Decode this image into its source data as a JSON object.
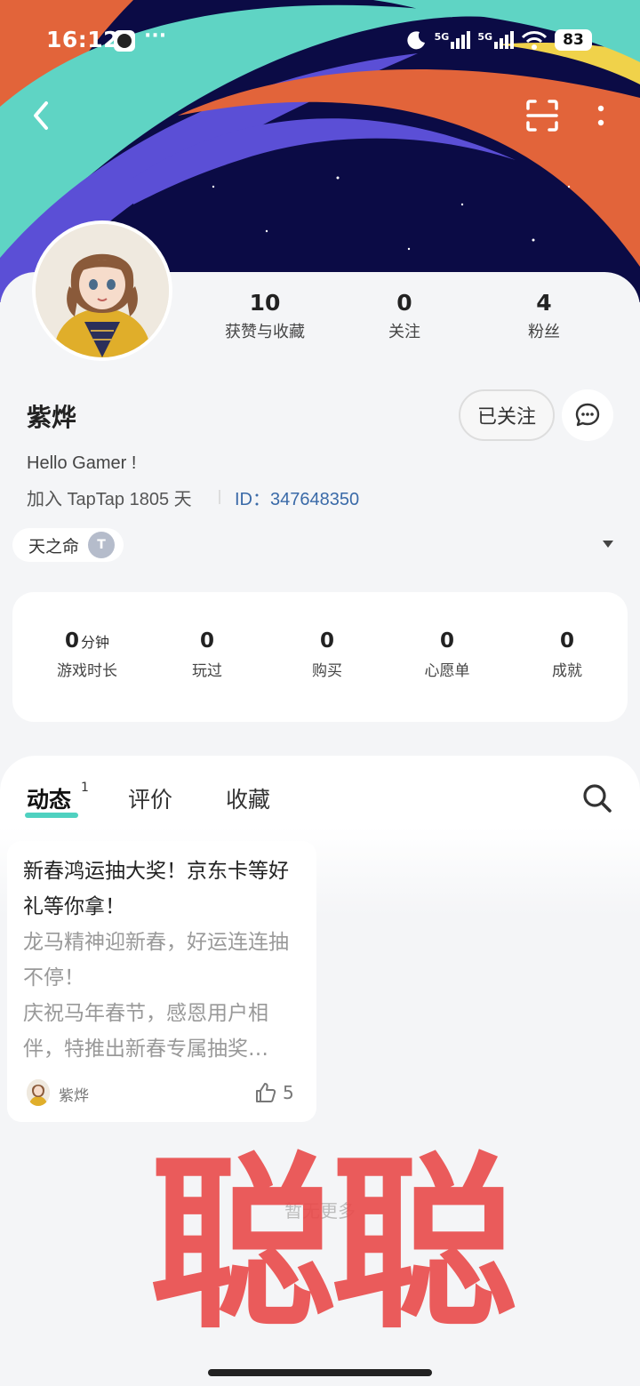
{
  "status_bar": {
    "time": "16:12",
    "more_indicator": "···",
    "signal_1": "5G",
    "signal_2": "5G",
    "battery": "83"
  },
  "nav": {
    "icons": [
      "back-icon",
      "scan-icon",
      "more-icon"
    ]
  },
  "profile": {
    "username": "紫烨",
    "bio": "Hello Gamer !",
    "joined": "加入 TapTap 1805 天",
    "id_text": "ID：347648350",
    "follow_label": "已关注",
    "stats": [
      {
        "num": "10",
        "label": "获赞与收藏"
      },
      {
        "num": "0",
        "label": "关注"
      },
      {
        "num": "4",
        "label": "粉丝"
      }
    ],
    "tag": {
      "label": "天之命",
      "badge": "T"
    }
  },
  "game_stats": [
    {
      "num": "0",
      "unit": "分钟",
      "label": "游戏时长"
    },
    {
      "num": "0",
      "unit": "",
      "label": "玩过"
    },
    {
      "num": "0",
      "unit": "",
      "label": "购买"
    },
    {
      "num": "0",
      "unit": "",
      "label": "心愿单"
    },
    {
      "num": "0",
      "unit": "",
      "label": "成就"
    }
  ],
  "tabs": {
    "items": [
      "动态",
      "评价",
      "收藏"
    ],
    "active_superscript": "1"
  },
  "post": {
    "title": "新春鸿运抽大奖！京东卡等好礼等你拿！",
    "body": "龙马精神迎新春，好运连连抽不停！\n庆祝马年春节，感恩用户相伴，特推出新春专属抽奖…",
    "author": "紫烨",
    "likes": "5"
  },
  "footer": {
    "no_more": "暂无更多"
  },
  "watermark": "聪聪",
  "colors": {
    "accent": "#4fd1c0",
    "id_link": "#3a6aa8",
    "banner_bg": "#0b0b45",
    "watermark": "#ea4b4b"
  }
}
